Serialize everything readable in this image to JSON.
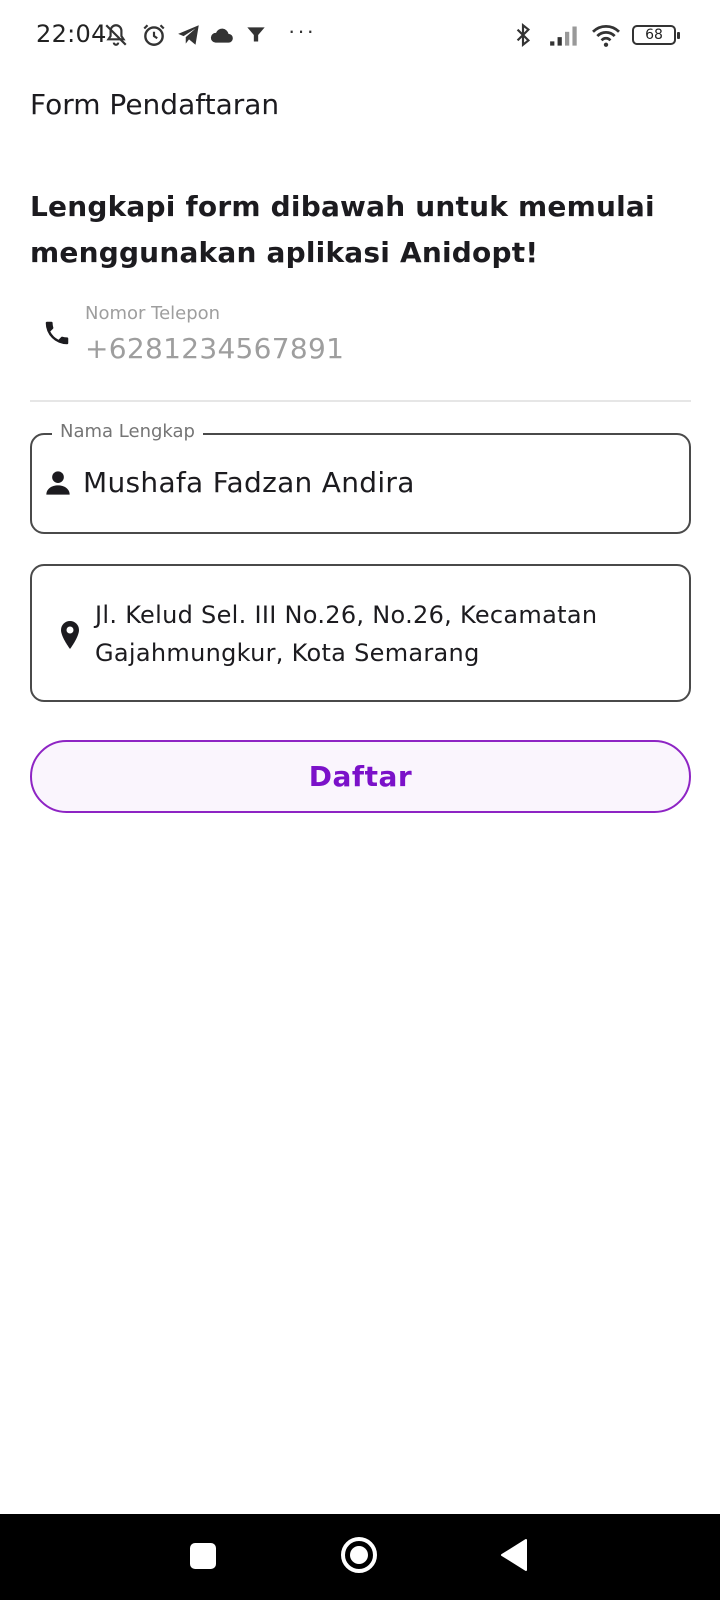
{
  "status_bar": {
    "time": "22:04",
    "battery": "68",
    "icons_left": [
      "muted-bell-icon",
      "alarm-icon",
      "telegram-icon",
      "cloud-icon",
      "filter-icon",
      "more-dots-icon"
    ],
    "icons_right": [
      "bluetooth-icon",
      "signal-icon",
      "wifi-icon",
      "battery-icon"
    ],
    "more_dots": "···"
  },
  "header": {
    "title": "Form Pendaftaran"
  },
  "intro": {
    "text": "Lengkapi form dibawah untuk memulai menggunakan aplikasi Anidopt!"
  },
  "form": {
    "phone": {
      "label": "Nomor Telepon",
      "value": "+6281234567891",
      "icon": "phone-icon",
      "enabled": false
    },
    "name": {
      "label": "Nama Lengkap",
      "value": "Mushafa Fadzan Andira",
      "icon": "person-icon"
    },
    "address": {
      "value": "Jl. Kelud Sel. III No.26, No.26, Kecamatan Gajahmungkur, Kota Semarang",
      "icon": "location-pin-icon"
    },
    "submit_label": "Daftar"
  },
  "nav_bar": {
    "buttons": [
      "recent-apps-icon",
      "home-icon",
      "back-icon"
    ]
  },
  "colors": {
    "accent": "#7b11c9",
    "accent_border": "#8e24c4",
    "button_bg": "#faf5fd",
    "muted_text": "#9e9e9e",
    "field_border": "#4a4a4a"
  }
}
